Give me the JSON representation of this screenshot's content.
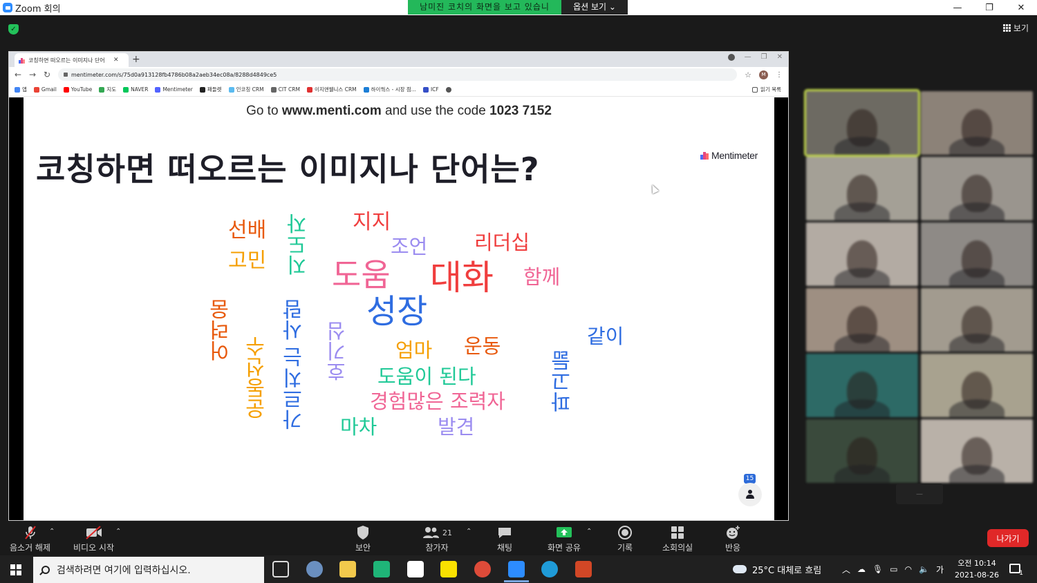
{
  "window": {
    "title": "Zoom 회의",
    "share_notice": "남미진 코치의 화면을 보고 있습니다.",
    "view_options": "옵션 보기 ⌄"
  },
  "zoom": {
    "view_label": "보기"
  },
  "chrome": {
    "tab_title": "코칭하면 떠오르는 이미지나 단어",
    "url": "mentimeter.com/s/75d0a913128fb4786b08a2aeb34ec08a/8288d4849ce5",
    "bookmarks": [
      "앱",
      "Gmail",
      "YouTube",
      "지도",
      "NAVER",
      "Mentimeter",
      "패들렛",
      "인코칭 CRM",
      "CIT CRM",
      "이지앤웰니스 CRM",
      "하이웍스 - 시장 점...",
      "ICF"
    ],
    "reading_list": "읽기 목록",
    "profile_initial": "M"
  },
  "slide": {
    "code_prefix": "Go to ",
    "code_site": "www.menti.com",
    "code_middle": " and use the code ",
    "code_number": "1023 7152",
    "question": "코칭하면 떠오르는 이미지나 단어는?",
    "brand": "Mentimeter",
    "participants": "15",
    "colors": {
      "red": "#f03e3e",
      "pink": "#f06595",
      "blue": "#2f6de1",
      "green": "#20c997",
      "orange": "#e8590c",
      "amber": "#f59f00",
      "lavender": "#9b8cf0"
    },
    "words": [
      {
        "text": "대화",
        "color": "#f03e3e"
      },
      {
        "text": "성장",
        "color": "#2f6de1"
      },
      {
        "text": "도움",
        "color": "#f06595"
      },
      {
        "text": "지지",
        "color": "#f03e3e"
      },
      {
        "text": "리더십",
        "color": "#f03e3e"
      },
      {
        "text": "조언",
        "color": "#9b8cf0"
      },
      {
        "text": "함께",
        "color": "#f06595"
      },
      {
        "text": "선배",
        "color": "#e8590c"
      },
      {
        "text": "고민",
        "color": "#f59f00"
      },
      {
        "text": "지도자",
        "color": "#20c997"
      },
      {
        "text": "어려움",
        "color": "#e8590c"
      },
      {
        "text": "운동선수",
        "color": "#f59f00"
      },
      {
        "text": "가르치는 사람",
        "color": "#2f6de1"
      },
      {
        "text": "호기심",
        "color": "#9b8cf0"
      },
      {
        "text": "엄마",
        "color": "#f59f00"
      },
      {
        "text": "운동",
        "color": "#e8590c"
      },
      {
        "text": "같이",
        "color": "#2f6de1"
      },
      {
        "text": "도움이 된다",
        "color": "#20c997"
      },
      {
        "text": "경험많은 조력자",
        "color": "#f06595"
      },
      {
        "text": "마차",
        "color": "#20c997"
      },
      {
        "text": "발견",
        "color": "#9b8cf0"
      },
      {
        "text": "파고듦",
        "color": "#2f6de1"
      }
    ]
  },
  "toolbar": {
    "mute": "음소거 해제",
    "video": "비디오 시작",
    "security": "보안",
    "participants": "참가자",
    "participants_count": "21",
    "chat": "채팅",
    "share": "화면 공유",
    "record": "기록",
    "breakout": "소회의실",
    "reactions": "반응",
    "leave": "나가기"
  },
  "taskbar": {
    "search_placeholder": "검색하려면 여기에 입력하십시오.",
    "weather": "25°C  대체로 흐림",
    "ime": "가",
    "time": "오전 10:14",
    "date": "2021-08-26",
    "notifications": "1"
  }
}
